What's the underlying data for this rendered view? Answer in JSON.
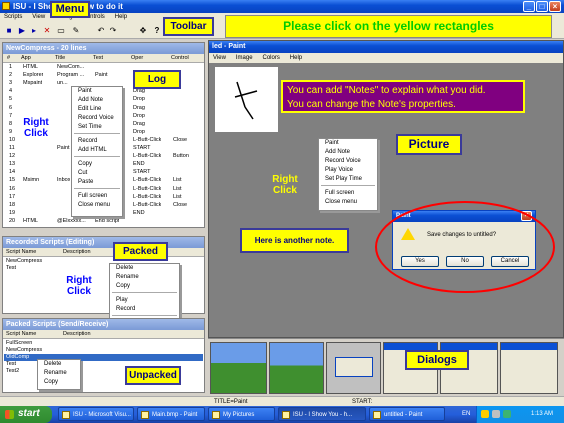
{
  "app": {
    "title": "ISU - I Show You how to do it",
    "menu": [
      "Scripts",
      "View",
      "Config",
      "Controls",
      "Help"
    ],
    "window_buttons": [
      "_",
      "□",
      "×"
    ]
  },
  "toolbar_icons": [
    "stop-square-icon",
    "play-icon",
    "step-icon",
    "delete-x-icon",
    "note-icon",
    "edit-icon",
    "rewind-icon",
    "forward-icon",
    "move-icon",
    "help-icon"
  ],
  "toolbar_glyphs": [
    "■",
    "▶",
    "▸",
    "✕",
    "▭",
    "✎",
    "↶",
    "↷",
    "✥",
    "?"
  ],
  "annotations": {
    "menu": "Menu",
    "toolbar": "Toolbar",
    "banner": "Please click on the yellow rectangles",
    "log": "Log",
    "packed": "Packed",
    "unpacked": "Unpacked",
    "picture": "Picture",
    "dialogs": "Dialogs",
    "right_click": "Right Click",
    "notes_line1": "You can add \"Notes\" to explain what you did.",
    "notes_line2": "You can change the Note's properties.",
    "another_note": "Here is another note."
  },
  "log_panel": {
    "title": "NewCompress - 20 lines",
    "columns": [
      "#",
      "App",
      "Title",
      "Text",
      "Oper",
      "Control"
    ],
    "rows": [
      [
        "1",
        "HTML",
        "NewCom...",
        "",
        "",
        ""
      ],
      [
        "2",
        "Explorer",
        "Program ...",
        "Paint",
        "L-B",
        ""
      ],
      [
        "3",
        "Mspaint",
        "un...",
        "",
        "L-B",
        ""
      ],
      [
        "4",
        "",
        "",
        "",
        "Drag",
        ""
      ],
      [
        "5",
        "",
        "",
        "",
        "Drop",
        ""
      ],
      [
        "6",
        "",
        "",
        "",
        "Drag",
        ""
      ],
      [
        "7",
        "",
        "",
        "",
        "Drop",
        ""
      ],
      [
        "8",
        "",
        "",
        "",
        "Drag",
        ""
      ],
      [
        "9",
        "",
        "",
        "",
        "Drop",
        ""
      ],
      [
        "10",
        "",
        "",
        "",
        "L-Butt-Click",
        "Close"
      ],
      [
        "11",
        "",
        "Paint",
        "",
        "START",
        ""
      ],
      [
        "12",
        "",
        "",
        "",
        "L-Butt-Click",
        "Button"
      ],
      [
        "13",
        "",
        "",
        "",
        "END",
        ""
      ],
      [
        "14",
        "",
        "",
        "",
        "START",
        ""
      ],
      [
        "15",
        "Msimn",
        "Inbox",
        "",
        "L-Butt-Click",
        "List"
      ],
      [
        "16",
        "",
        "",
        "",
        "L-Butt-Click",
        "List"
      ],
      [
        "17",
        "",
        "",
        "",
        "L-Butt-Click",
        "List"
      ],
      [
        "18",
        "",
        "",
        "",
        "L-Butt-Click",
        "Close"
      ],
      [
        "19",
        "",
        "",
        "",
        "END",
        ""
      ],
      [
        "20",
        "HTML",
        "@Elxxxxx...",
        "End script",
        "",
        ""
      ]
    ],
    "context_menu": [
      "Paint",
      "Add Note",
      "Edit Line",
      "Record Voice",
      "Set Time",
      "-",
      "Record",
      "Add HTML",
      "-",
      "Copy",
      "Cut",
      "Paste",
      "-",
      "Full screen",
      "Close menu"
    ]
  },
  "recorded_panel": {
    "title": "Recorded Scripts (Editing)",
    "columns": [
      "Script Name",
      "Description"
    ],
    "rows": [
      "NewCompress",
      "Test"
    ],
    "context_menu": [
      "Delete",
      "Rename",
      "Copy",
      "-",
      "Play",
      "Record",
      "-",
      "Change description",
      "Pack (to Send)"
    ]
  },
  "packed_panel": {
    "title": "Packed Scripts (Send/Receive)",
    "columns": [
      "Script Name",
      "Description"
    ],
    "rows": [
      "FullScreen",
      "NewCompress",
      "OldComp",
      "Test",
      "Test2"
    ],
    "context_menu": [
      "Delete",
      "Rename",
      "Copy"
    ]
  },
  "paint": {
    "title": "led - Paint",
    "menu": [
      "View",
      "Image",
      "Colors",
      "Help"
    ],
    "context_menu": [
      "Paint",
      "Add Note",
      "Record Voice",
      "Play Voice",
      "Set Play Time",
      "-",
      "Full screen",
      "Close menu"
    ]
  },
  "dialog": {
    "title": "Paint",
    "message": "Save changes to untitled?",
    "buttons": [
      "Yes",
      "No",
      "Cancel"
    ]
  },
  "status": {
    "left": "TITLE=Paint",
    "right": "START:"
  },
  "taskbar": {
    "start": "start",
    "buttons": [
      "ISU - Microsoft Visu...",
      "Main.bmp - Paint",
      "My Pictures",
      "ISU - I Show You - h...",
      "untitled - Paint"
    ],
    "lang": "EN",
    "clock": "1:13 AM"
  },
  "colors": {
    "annotation_yellow": "#ffff00",
    "banner_green": "#00cc00",
    "note_purple": "#800080",
    "xp_blue": "#0a4fd4",
    "circle_red": "#ff0000"
  }
}
